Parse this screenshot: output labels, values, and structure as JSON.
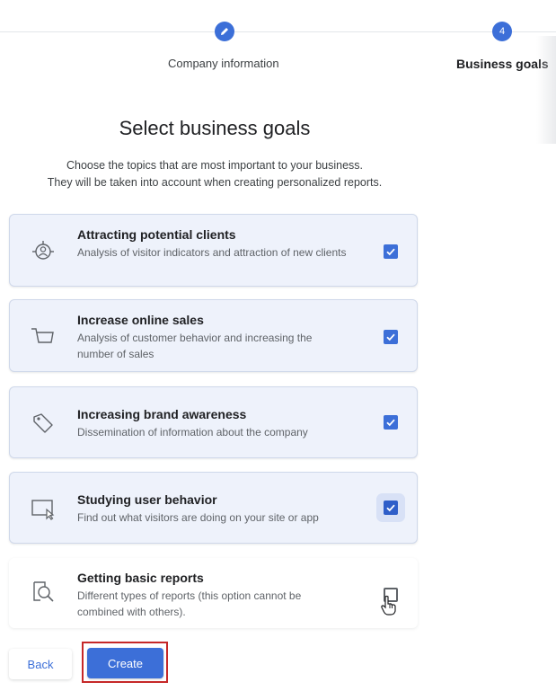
{
  "stepper": {
    "steps": [
      {
        "label": "Company information",
        "icon": "pencil-icon",
        "state": "completed"
      },
      {
        "label": "Business goals",
        "number": "4",
        "state": "current"
      }
    ]
  },
  "page": {
    "title": "Select business goals",
    "subtitle_line1": "Choose the topics that are most important to your business.",
    "subtitle_line2": "They will be taken into account when creating personalized reports."
  },
  "goals": [
    {
      "title": "Attracting potential clients",
      "desc": "Analysis of visitor indicators and attraction of new clients",
      "icon": "target-user-icon",
      "checked": true
    },
    {
      "title": "Increase online sales",
      "desc": "Analysis of customer behavior and increasing the number of sales",
      "icon": "shopping-cart-icon",
      "checked": true
    },
    {
      "title": "Increasing brand awareness",
      "desc": "Dissemination of information about the company",
      "icon": "tag-icon",
      "checked": true
    },
    {
      "title": "Studying user behavior",
      "desc": "Find out what visitors are doing on your site or app",
      "icon": "cursor-window-icon",
      "checked": true
    },
    {
      "title": "Getting basic reports",
      "desc": "Different types of reports (this option cannot be combined with others).",
      "icon": "report-search-icon",
      "checked": false
    }
  ],
  "actions": {
    "back_label": "Back",
    "create_label": "Create"
  },
  "colors": {
    "accent": "#3c6fd8",
    "selected_card_bg": "#eef2fb",
    "highlight_frame": "#c62828"
  }
}
